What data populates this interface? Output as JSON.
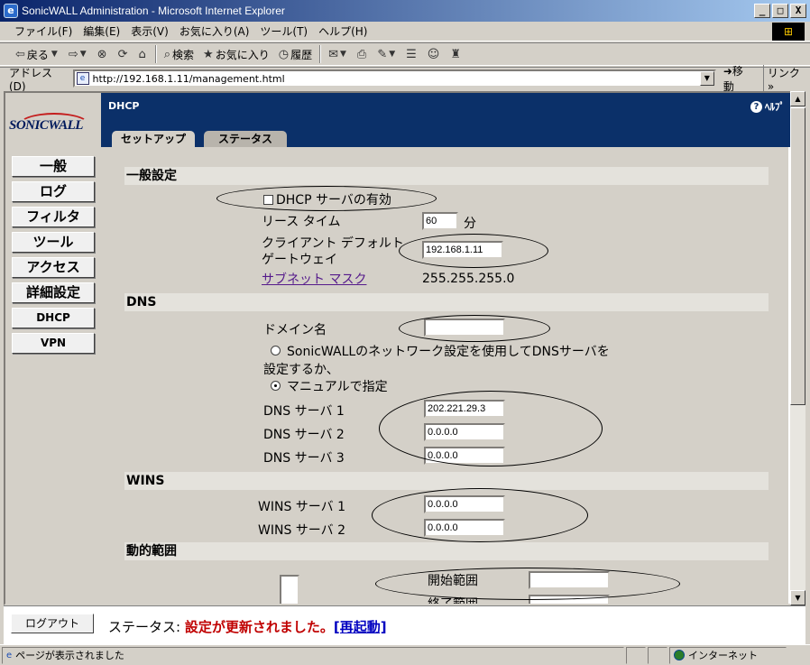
{
  "window": {
    "title": "SonicWALL Administration - Microsoft Internet Explorer",
    "buttons": [
      "_",
      "□",
      "X"
    ]
  },
  "menu": [
    "ファイル(F)",
    "編集(E)",
    "表示(V)",
    "お気に入り(A)",
    "ツール(T)",
    "ヘルプ(H)"
  ],
  "toolbar": {
    "back": "戻る",
    "search": "検索",
    "favorites": "お気に入り",
    "history": "履歴"
  },
  "address": {
    "label": "アドレス(D)",
    "url": "http://192.168.1.11/management.html",
    "go": "移動",
    "links": "リンク »"
  },
  "logo": "SONICWALL",
  "nav": [
    "一般",
    "ログ",
    "フィルタ",
    "ツール",
    "アクセス",
    "詳細設定",
    "DHCP",
    "VPN"
  ],
  "header": {
    "section": "DHCP",
    "help": "ﾍﾙﾌﾟ"
  },
  "tabs": {
    "setup": "セットアップ",
    "status": "ステータス"
  },
  "general": {
    "heading": "一般設定",
    "enable_label": "DHCP サーバの有効",
    "lease_label": "リース タイム",
    "lease_value": "60",
    "lease_unit": "分",
    "gateway_label_1": "クライアント デフォルト",
    "gateway_label_2": "ゲートウェイ",
    "gateway_value": "192.168.1.11",
    "subnet_label": "サブネット マスク",
    "subnet_value": "255.255.255.0"
  },
  "dns": {
    "heading": "DNS",
    "domain_label": "ドメイン名",
    "domain_value": "",
    "option_auto_1": "SonicWALLのネットワーク設定を使用してDNSサーバを",
    "option_auto_2": "設定するか、",
    "option_manual": "マニュアルで指定",
    "server1_label": "DNS サーバ 1",
    "server1_value": "202.221.29.3",
    "server2_label": "DNS サーバ 2",
    "server2_value": "0.0.0.0",
    "server3_label": "DNS サーバ 3",
    "server3_value": "0.0.0.0"
  },
  "wins": {
    "heading": "WINS",
    "server1_label": "WINS サーバ 1",
    "server1_value": "0.0.0.0",
    "server2_label": "WINS サーバ 2",
    "server2_value": "0.0.0.0"
  },
  "dynamic": {
    "heading": "動的範囲",
    "start_label": "開始範囲",
    "start_value": "",
    "end_label": "終了範囲",
    "end_value": ""
  },
  "footer": {
    "logout": "ログアウト",
    "status_prefix": "ステータス: ",
    "status_msg": "設定が更新されました。",
    "restart": "[再起動]"
  },
  "ie_status": {
    "text": "ページが表示されました",
    "zone": "インターネット"
  }
}
